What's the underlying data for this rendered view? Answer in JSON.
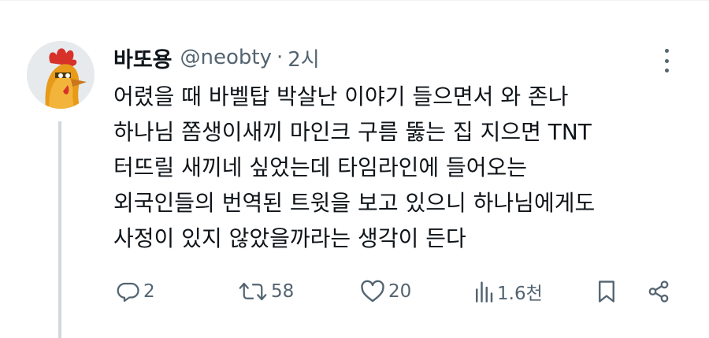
{
  "tweet": {
    "display_name": "바또용",
    "handle": "@neobty",
    "separator": "·",
    "time": "2시",
    "text_lines": [
      "어렸을 때 바벨탑 박살난 이야기 들으면서 와 존나",
      "하나님 쫌생이새끼 마인크 구름 뚫는 집 지으면 TNT",
      "터뜨릴 새끼네 싶었는데 타임라인에 들어오는",
      "외국인들의 번역된 트윗을 보고 있으니 하나님에게도",
      "사정이 있지 않았을까라는 생각이 든다"
    ]
  },
  "actions": {
    "reply_count": "2",
    "retweet_count": "58",
    "like_count": "20",
    "views_count": "1.6천"
  },
  "icons": {
    "reply": "reply-icon",
    "retweet": "retweet-icon",
    "like": "heart-icon",
    "views": "views-icon",
    "bookmark": "bookmark-icon",
    "share": "share-icon",
    "more": "more-icon"
  },
  "colors": {
    "text": "#0f1419",
    "secondary": "#536471",
    "thread_line": "#cfd9de"
  }
}
